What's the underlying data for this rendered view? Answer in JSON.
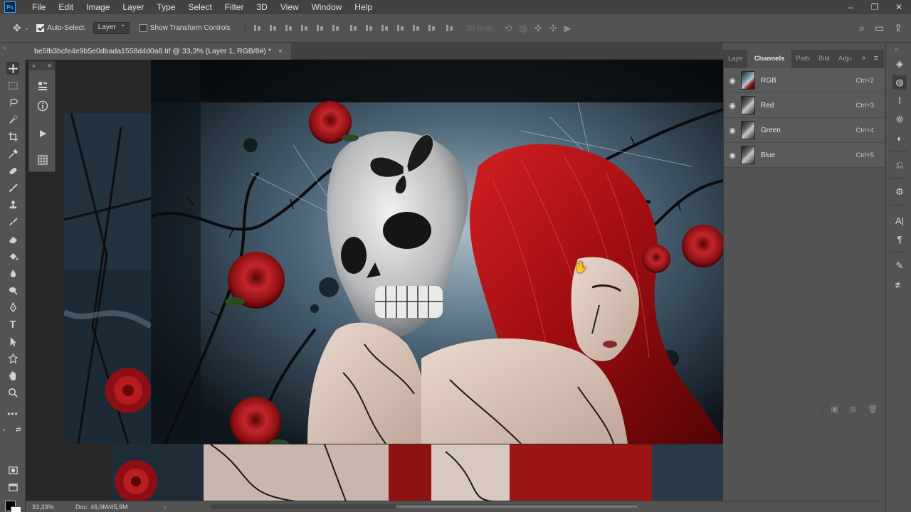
{
  "menubar": {
    "logo": "Ps",
    "items": [
      "File",
      "Edit",
      "Image",
      "Layer",
      "Type",
      "Select",
      "Filter",
      "3D",
      "View",
      "Window",
      "Help"
    ],
    "window_controls": [
      "minimize",
      "restore",
      "close"
    ]
  },
  "options_bar": {
    "auto_select_label": "Auto-Select:",
    "auto_select_checked": true,
    "target_select_value": "Layer",
    "show_transform_label": "Show Transform Controls",
    "show_transform_checked": false,
    "mode_3d_label": "3D Mode:"
  },
  "document_tab": {
    "title": "be5fb3bcfe4e9b5e0dbada1558d4d0a8.tif @ 33,3% (Layer 1, RGB/8#) *",
    "close": "×"
  },
  "toolbar": {
    "tools": [
      "move-tool",
      "rectangular-marquee-tool",
      "lasso-tool",
      "quick-selection-tool",
      "crop-tool",
      "eyedropper-tool",
      "healing-brush-tool",
      "brush-tool",
      "clone-stamp-tool",
      "history-brush-tool",
      "eraser-tool",
      "paint-bucket-tool",
      "blur-tool",
      "dodge-tool",
      "pen-tool",
      "type-tool",
      "path-selection-tool",
      "custom-shape-tool",
      "hand-tool",
      "zoom-tool",
      "more-tools"
    ],
    "foreground_color": "#000000",
    "background_color": "#ffffff"
  },
  "channels_panel": {
    "tabs": [
      "Laye",
      "Channels",
      "Path",
      "Bibl",
      "Adju"
    ],
    "active_tab": "Channels",
    "channels": [
      {
        "name": "RGB",
        "shortcut": "Ctrl+2",
        "visible": true
      },
      {
        "name": "Red",
        "shortcut": "Ctrl+3",
        "visible": true
      },
      {
        "name": "Green",
        "shortcut": "Ctrl+4",
        "visible": true
      },
      {
        "name": "Blue",
        "shortcut": "Ctrl+5",
        "visible": true
      }
    ]
  },
  "status_bar": {
    "zoom": "33,33%",
    "doc_info": "Doc: 46,9M/45,9M"
  },
  "colors": {
    "accent": "#31a8ff",
    "ui_bg": "#535353",
    "ui_dark": "#424242"
  }
}
